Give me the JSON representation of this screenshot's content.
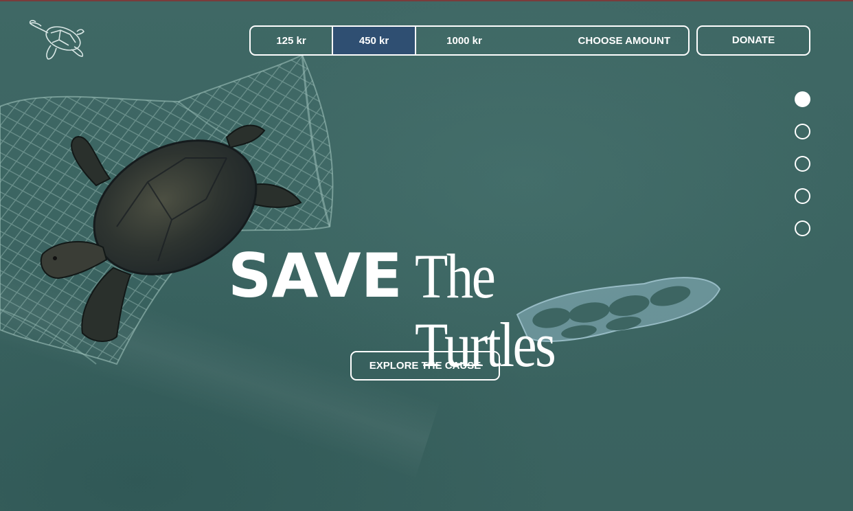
{
  "theme": {
    "background": "#3d6562",
    "accent_selected": "#2f4f72",
    "text": "#ffffff"
  },
  "header": {
    "logo_icon": "turtle-outline-icon",
    "amounts": [
      {
        "label": "125 kr",
        "selected": false
      },
      {
        "label": "450 kr",
        "selected": true
      },
      {
        "label": "1000 kr",
        "selected": false
      }
    ],
    "choose_amount_label": "CHOOSE AMOUNT",
    "donate_label": "DONATE"
  },
  "pager": {
    "count": 5,
    "active_index": 0
  },
  "hero": {
    "title_bold": "SAVE",
    "title_serif": "The Turtles",
    "cta_label": "EXPLORE THE CAUSE",
    "images": [
      "sea-turtle-in-net",
      "plastic-six-pack-rings"
    ]
  }
}
